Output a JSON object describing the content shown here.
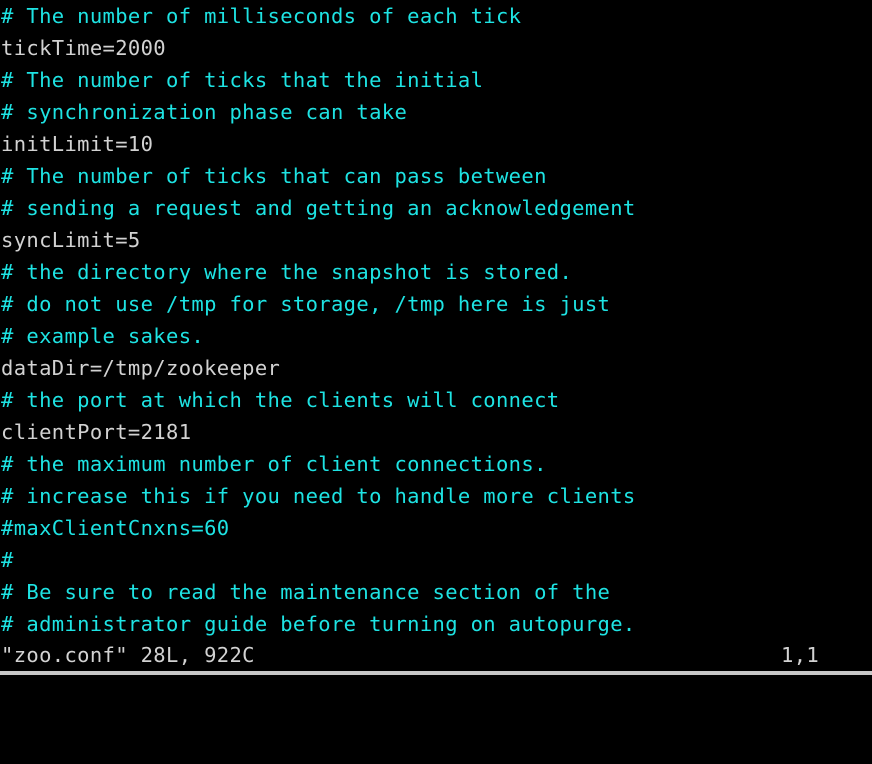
{
  "terminal": {
    "background_color": "#000000",
    "comment_color": "#1ee3e3",
    "text_color": "#d2d2d2",
    "bottom_strip_color": "#c8c8c8"
  },
  "editor": {
    "lines": [
      {
        "text": "# The number of milliseconds of each tick",
        "kind": "comment"
      },
      {
        "text": "tickTime=2000",
        "kind": "setting"
      },
      {
        "text": "# The number of ticks that the initial",
        "kind": "comment"
      },
      {
        "text": "# synchronization phase can take",
        "kind": "comment"
      },
      {
        "text": "initLimit=10",
        "kind": "setting"
      },
      {
        "text": "# The number of ticks that can pass between",
        "kind": "comment"
      },
      {
        "text": "# sending a request and getting an acknowledgement",
        "kind": "comment"
      },
      {
        "text": "syncLimit=5",
        "kind": "setting"
      },
      {
        "text": "# the directory where the snapshot is stored.",
        "kind": "comment"
      },
      {
        "text": "# do not use /tmp for storage, /tmp here is just",
        "kind": "comment"
      },
      {
        "text": "# example sakes.",
        "kind": "comment"
      },
      {
        "text": "dataDir=/tmp/zookeeper",
        "kind": "setting"
      },
      {
        "text": "# the port at which the clients will connect",
        "kind": "comment"
      },
      {
        "text": "clientPort=2181",
        "kind": "setting"
      },
      {
        "text": "# the maximum number of client connections.",
        "kind": "comment"
      },
      {
        "text": "# increase this if you need to handle more clients",
        "kind": "comment"
      },
      {
        "text": "#maxClientCnxns=60",
        "kind": "comment"
      },
      {
        "text": "#",
        "kind": "comment"
      },
      {
        "text": "# Be sure to read the maintenance section of the",
        "kind": "comment"
      },
      {
        "text": "# administrator guide before turning on autopurge.",
        "kind": "comment"
      }
    ]
  },
  "statusline": {
    "file_info": "\"zoo.conf\" 28L, 922C",
    "cursor_position": "1,1"
  }
}
